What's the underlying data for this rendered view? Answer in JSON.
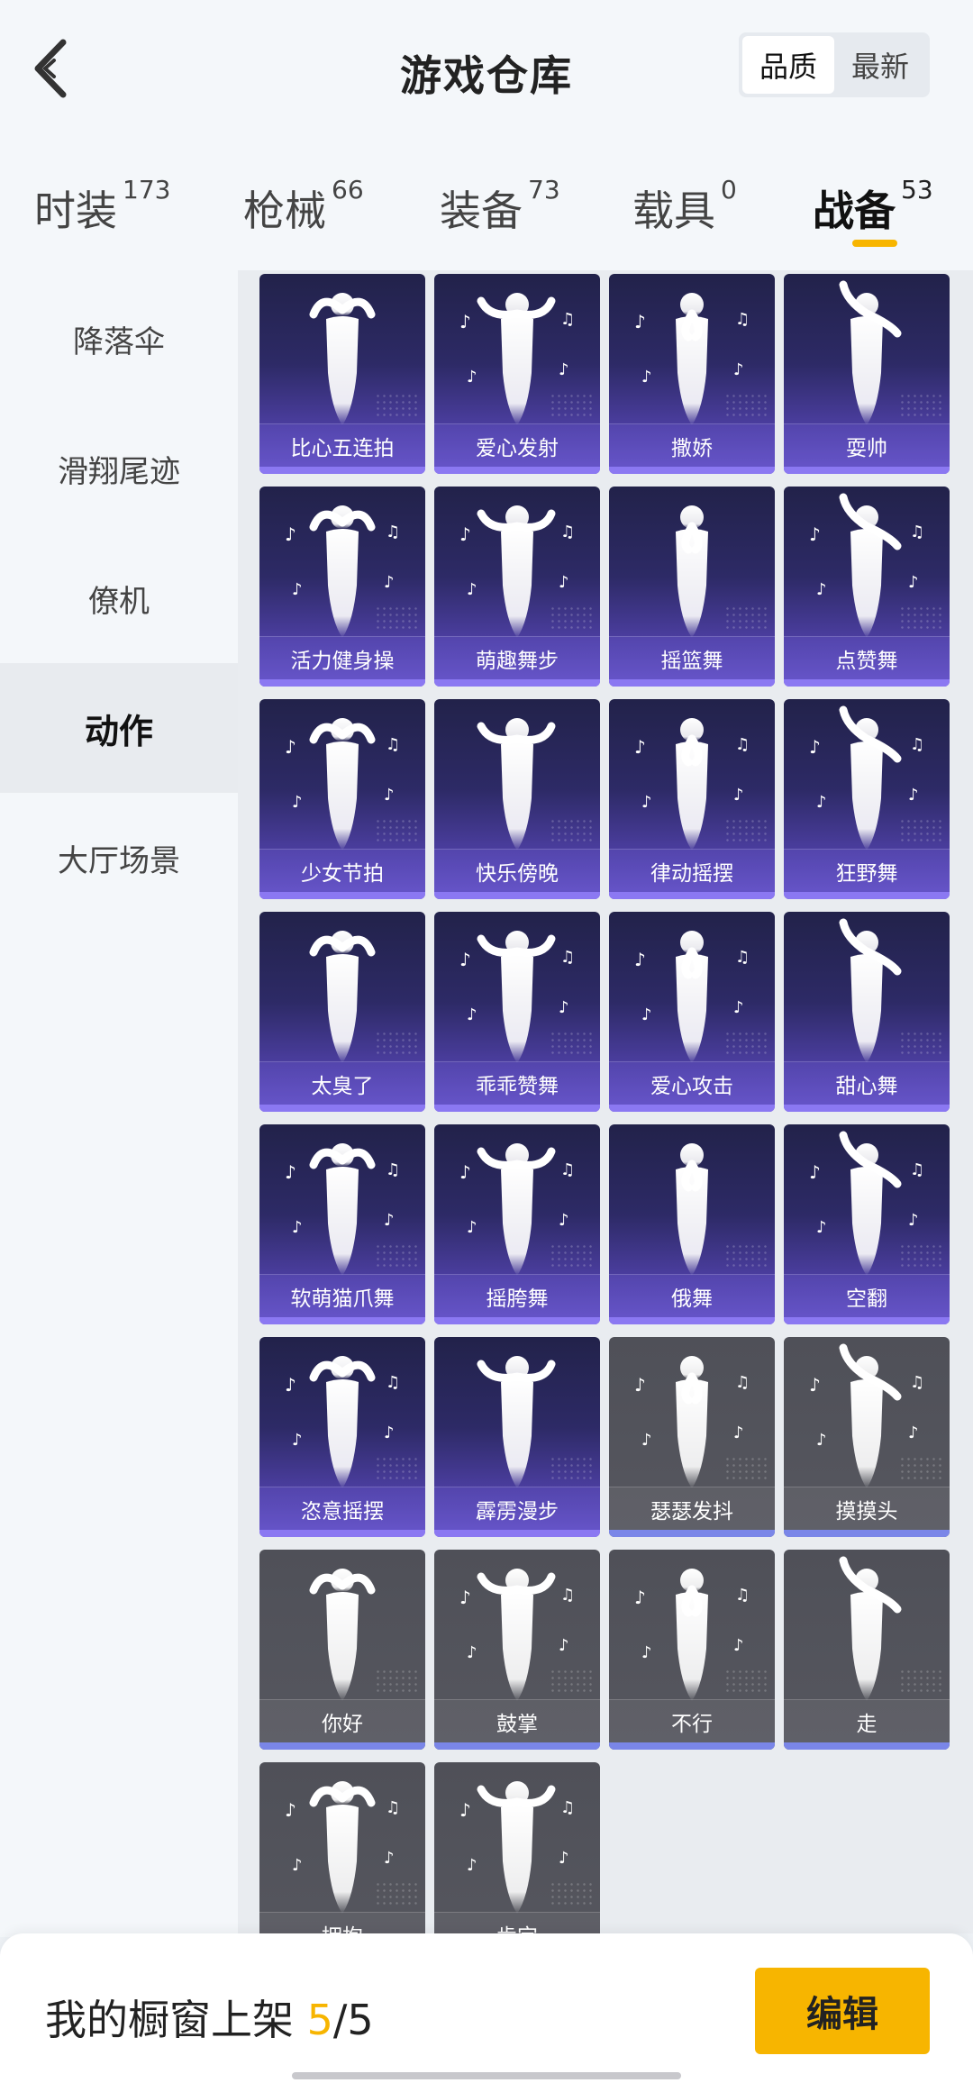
{
  "header": {
    "title": "游戏仓库",
    "sort_options": [
      "品质",
      "最新"
    ],
    "sort_selected": "品质"
  },
  "tabs": [
    {
      "label": "时装",
      "count": "173"
    },
    {
      "label": "枪械",
      "count": "66"
    },
    {
      "label": "装备",
      "count": "73"
    },
    {
      "label": "载具",
      "count": "0"
    },
    {
      "label": "战备",
      "count": "53",
      "active": true
    }
  ],
  "sidebar": {
    "items": [
      "降落伞",
      "滑翔尾迹",
      "僚机",
      "动作",
      "大厅场景"
    ],
    "active": "动作"
  },
  "items": [
    {
      "name": "比心五连拍",
      "rarity": "rare"
    },
    {
      "name": "爱心发射",
      "rarity": "rare"
    },
    {
      "name": "撒娇",
      "rarity": "rare"
    },
    {
      "name": "耍帅",
      "rarity": "rare"
    },
    {
      "name": "活力健身操",
      "rarity": "rare"
    },
    {
      "name": "萌趣舞步",
      "rarity": "rare"
    },
    {
      "name": "摇篮舞",
      "rarity": "rare"
    },
    {
      "name": "点赞舞",
      "rarity": "rare"
    },
    {
      "name": "少女节拍",
      "rarity": "rare"
    },
    {
      "name": "快乐傍晚",
      "rarity": "rare"
    },
    {
      "name": "律动摇摆",
      "rarity": "rare"
    },
    {
      "name": "狂野舞",
      "rarity": "rare"
    },
    {
      "name": "太臭了",
      "rarity": "rare"
    },
    {
      "name": "乖乖赞舞",
      "rarity": "rare"
    },
    {
      "name": "爱心攻击",
      "rarity": "rare"
    },
    {
      "name": "甜心舞",
      "rarity": "rare"
    },
    {
      "name": "软萌猫爪舞",
      "rarity": "rare"
    },
    {
      "name": "摇胯舞",
      "rarity": "rare"
    },
    {
      "name": "俄舞",
      "rarity": "rare"
    },
    {
      "name": "空翻",
      "rarity": "rare"
    },
    {
      "name": "恣意摇摆",
      "rarity": "rare"
    },
    {
      "name": "霹雳漫步",
      "rarity": "rare"
    },
    {
      "name": "瑟瑟发抖",
      "rarity": "common"
    },
    {
      "name": "摸摸头",
      "rarity": "common"
    },
    {
      "name": "你好",
      "rarity": "common"
    },
    {
      "name": "鼓掌",
      "rarity": "common"
    },
    {
      "name": "不行",
      "rarity": "common"
    },
    {
      "name": "走",
      "rarity": "common"
    },
    {
      "name": "拥抱",
      "rarity": "common"
    },
    {
      "name": "肯定",
      "rarity": "common"
    }
  ],
  "footer": {
    "label": "我的橱窗上架",
    "current": "5",
    "separator": "/",
    "total": "5",
    "edit_label": "编辑"
  },
  "colors": {
    "accent": "#f7b500",
    "rare_card": "#2d2a66",
    "common_card": "#56575f"
  },
  "icons": {
    "back": "chevron-left-icon",
    "figure": "dancer-silhouette-icon",
    "note": "music-note-icon"
  }
}
